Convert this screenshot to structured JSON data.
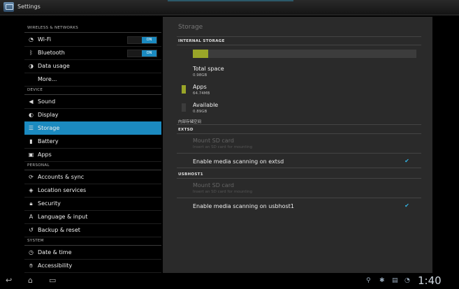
{
  "app": {
    "title": "Settings"
  },
  "sidebar": {
    "sections": [
      {
        "header": "WIRELESS & NETWORKS",
        "items": [
          {
            "label": "Wi-Fi",
            "icon": "wifi-icon",
            "toggle": "ON"
          },
          {
            "label": "Bluetooth",
            "icon": "bluetooth-icon",
            "toggle": "ON"
          },
          {
            "label": "Data usage",
            "icon": "data-usage-icon"
          },
          {
            "label": "More..."
          }
        ]
      },
      {
        "header": "DEVICE",
        "items": [
          {
            "label": "Sound",
            "icon": "speaker-icon"
          },
          {
            "label": "Display",
            "icon": "display-icon"
          },
          {
            "label": "Storage",
            "icon": "storage-icon",
            "active": true
          },
          {
            "label": "Battery",
            "icon": "battery-icon"
          },
          {
            "label": "Apps",
            "icon": "apps-icon"
          }
        ]
      },
      {
        "header": "PERSONAL",
        "items": [
          {
            "label": "Accounts & sync",
            "icon": "sync-icon"
          },
          {
            "label": "Location services",
            "icon": "location-icon"
          },
          {
            "label": "Security",
            "icon": "lock-icon"
          },
          {
            "label": "Language & input",
            "icon": "language-icon"
          },
          {
            "label": "Backup & reset",
            "icon": "backup-icon"
          }
        ]
      },
      {
        "header": "SYSTEM",
        "items": [
          {
            "label": "Date & time",
            "icon": "clock-icon"
          },
          {
            "label": "Accessibility",
            "icon": "hand-icon"
          }
        ]
      }
    ]
  },
  "storage": {
    "page_title": "Storage",
    "internal_header": "INTERNAL STORAGE",
    "used_fraction": 0.07,
    "total": {
      "label": "Total space",
      "value": "0.98GB"
    },
    "apps": {
      "label": "Apps",
      "value": "64.74MB",
      "color": "#99a528"
    },
    "available": {
      "label": "Available",
      "value": "0.89GB",
      "color": "#3c3c3c"
    },
    "internal_caption": "内部存储空间",
    "extsd_header": "EXTSD",
    "extsd_mount": {
      "label": "Mount SD card",
      "sub": "Insert an SD card for mounting"
    },
    "extsd_scan": {
      "label": "Enable media scanning on extsd",
      "checked": true
    },
    "usbhost_header": "USBHOST1",
    "usbhost_mount": {
      "label": "Mount SD card",
      "sub": "Insert an SD card for mounting"
    },
    "usbhost_scan": {
      "label": "Enable media scanning on usbhost1",
      "checked": true
    }
  },
  "status": {
    "time": "1:40"
  },
  "colors": {
    "accent": "#1b8ac0",
    "check": "#33b5e5"
  }
}
